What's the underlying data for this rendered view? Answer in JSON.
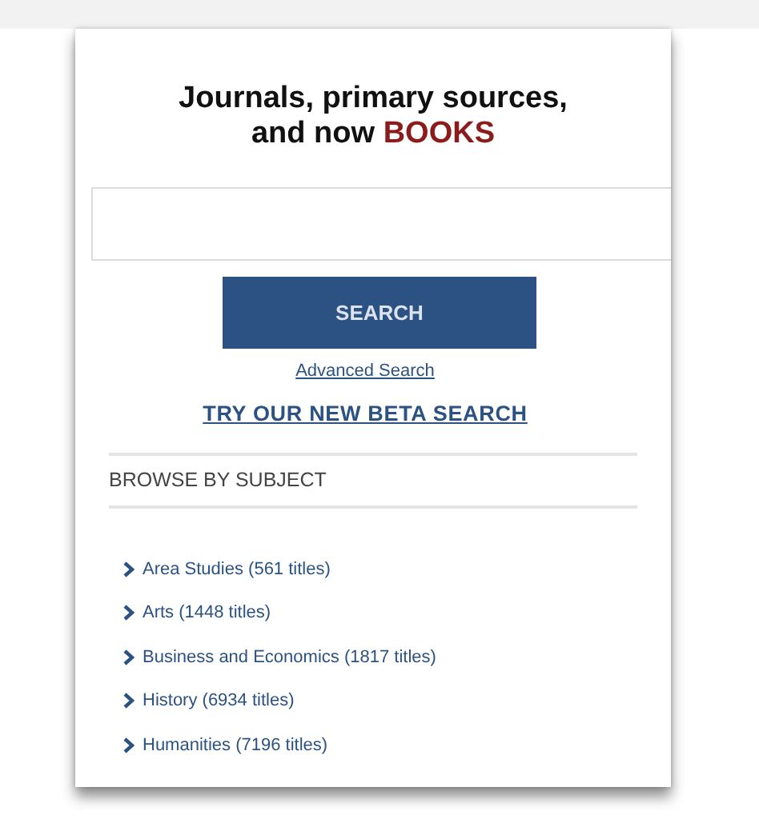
{
  "heading": {
    "text": "Journals, primary sources, and now",
    "highlight": "BOOKS"
  },
  "search": {
    "button": "SEARCH"
  },
  "links": [
    {
      "label": "Advanced Search",
      "kind": "small"
    },
    {
      "label": "TRY OUR NEW BETA SEARCH",
      "kind": "bold"
    }
  ],
  "browse": {
    "title": "BROWSE BY SUBJECT",
    "items": [
      {
        "label": "Area Studies (561 titles)"
      },
      {
        "label": "Arts (1448 titles)"
      },
      {
        "label": "Business and Economics (1817 titles)"
      },
      {
        "label": "History (6934 titles)"
      },
      {
        "label": "Humanities (7196 titles)"
      }
    ]
  }
}
